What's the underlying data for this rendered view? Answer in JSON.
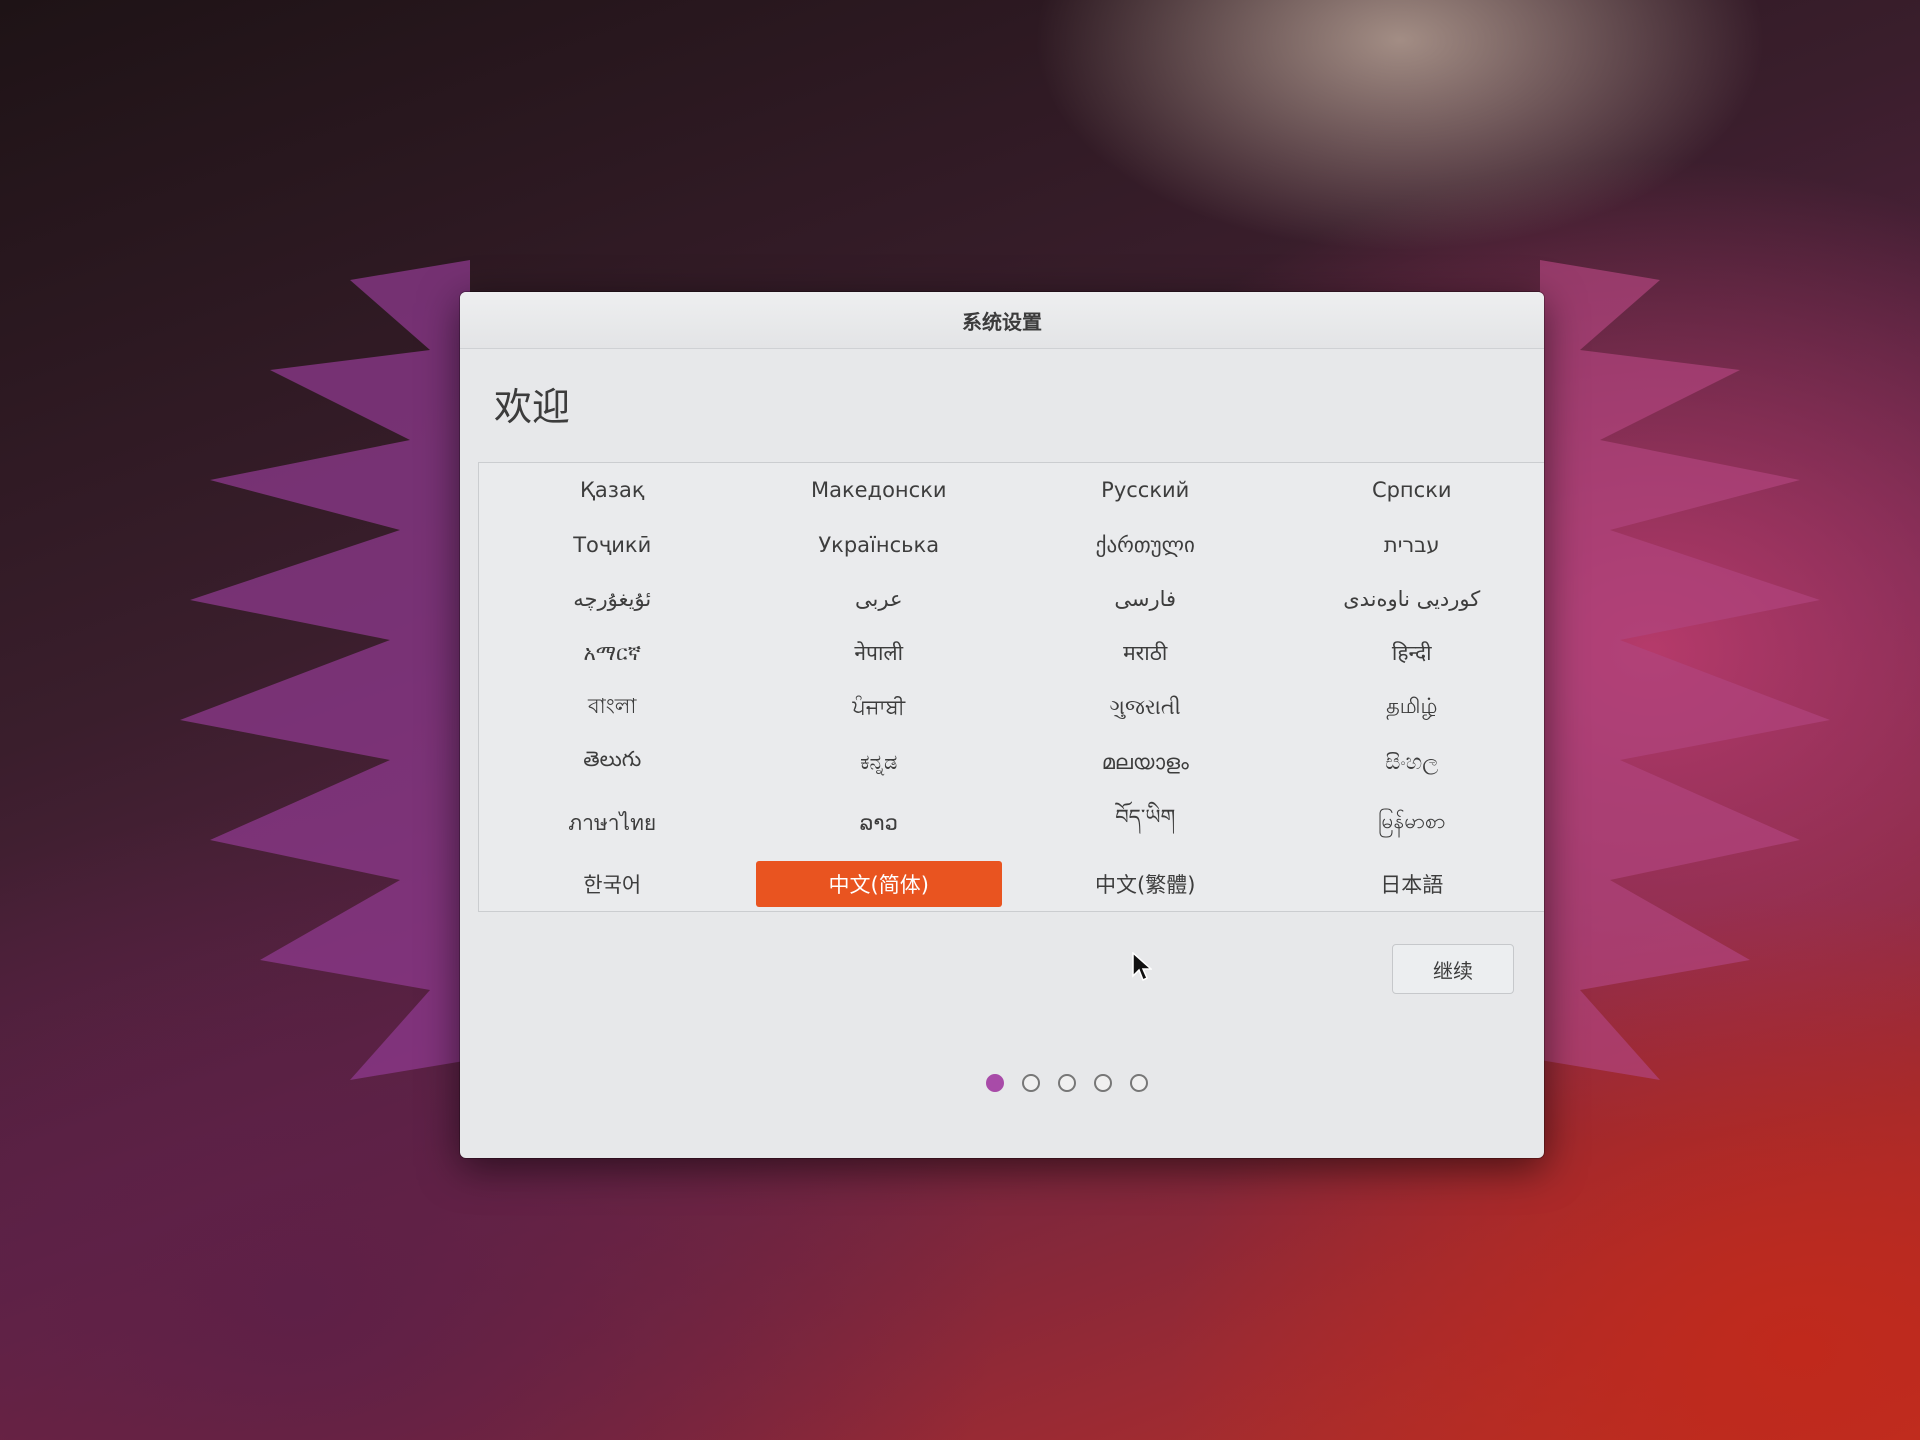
{
  "window": {
    "title": "系统设置"
  },
  "page": {
    "heading": "欢迎"
  },
  "languages": [
    "Қазақ",
    "Македонски",
    "Русский",
    "Српски",
    "Тоҷикӣ",
    "Українська",
    "ქართული",
    "עברית",
    "ئۇيغۇرچە",
    "عربى",
    "فارسی",
    "کوردیی ناوەندی",
    "አማርኛ",
    "नेपाली",
    "मराठी",
    "हिन्दी",
    "বাংলা",
    "ਪੰਜਾਬੀ",
    "ગુજરાતી",
    "தமிழ்",
    "తెలుగు",
    "ಕನ್ನಡ",
    "മലയാളം",
    "සිංහල",
    "ภาษาไทย",
    "ລາວ",
    "བོད་ཡིག",
    "မြန်မာစာ",
    "한국어",
    "中文(简体)",
    "中文(繁體)",
    "日本語"
  ],
  "selected_language": "中文(简体)",
  "continue_label": "继续",
  "pager": {
    "total": 5,
    "current": 1
  },
  "colors": {
    "accent": "#e95420",
    "pager_active": "#a84ba8"
  }
}
